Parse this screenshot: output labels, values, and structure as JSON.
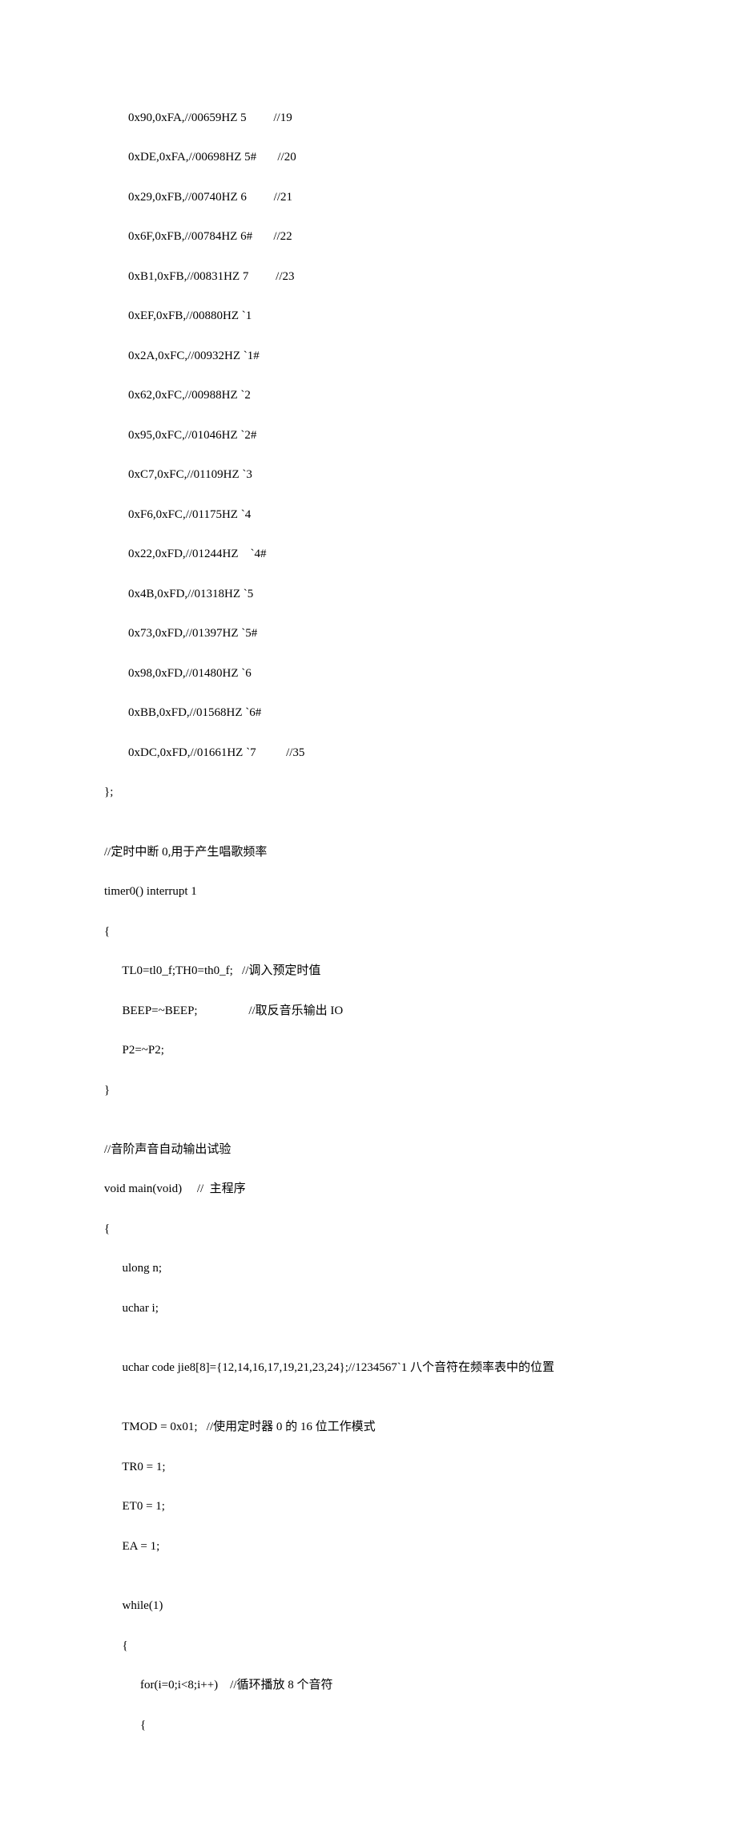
{
  "lines": [
    "        0x90,0xFA,//00659HZ 5         //19",
    "        0xDE,0xFA,//00698HZ 5#       //20",
    "        0x29,0xFB,//00740HZ 6         //21",
    "        0x6F,0xFB,//00784HZ 6#       //22",
    "        0xB1,0xFB,//00831HZ 7         //23",
    "        0xEF,0xFB,//00880HZ `1",
    "        0x2A,0xFC,//00932HZ `1#",
    "        0x62,0xFC,//00988HZ `2",
    "        0x95,0xFC,//01046HZ `2#",
    "        0xC7,0xFC,//01109HZ `3",
    "        0xF6,0xFC,//01175HZ `4",
    "        0x22,0xFD,//01244HZ    `4#",
    "        0x4B,0xFD,//01318HZ `5",
    "        0x73,0xFD,//01397HZ `5#",
    "        0x98,0xFD,//01480HZ `6",
    "        0xBB,0xFD,//01568HZ `6#",
    "        0xDC,0xFD,//01661HZ `7          //35",
    "};",
    "",
    "//定时中断 0,用于产生唱歌频率",
    "timer0() interrupt 1",
    "{",
    "      TL0=tl0_f;TH0=th0_f;   //调入预定时值",
    "      BEEP=~BEEP;                 //取反音乐输出 IO",
    "      P2=~P2;",
    "}",
    "",
    "//音阶声音自动输出试验",
    "void main(void)     //  主程序",
    "{",
    "      ulong n;",
    "      uchar i;",
    "",
    "      uchar code jie8[8]={12,14,16,17,19,21,23,24};//1234567`1 八个音符在频率表中的位置",
    "",
    "      TMOD = 0x01;   //使用定时器 0 的 16 位工作模式",
    "      TR0 = 1;",
    "      ET0 = 1;",
    "      EA = 1;",
    "",
    "      while(1)",
    "      {",
    "            for(i=0;i<8;i++)    //循环播放 8 个音符",
    "            {"
  ]
}
